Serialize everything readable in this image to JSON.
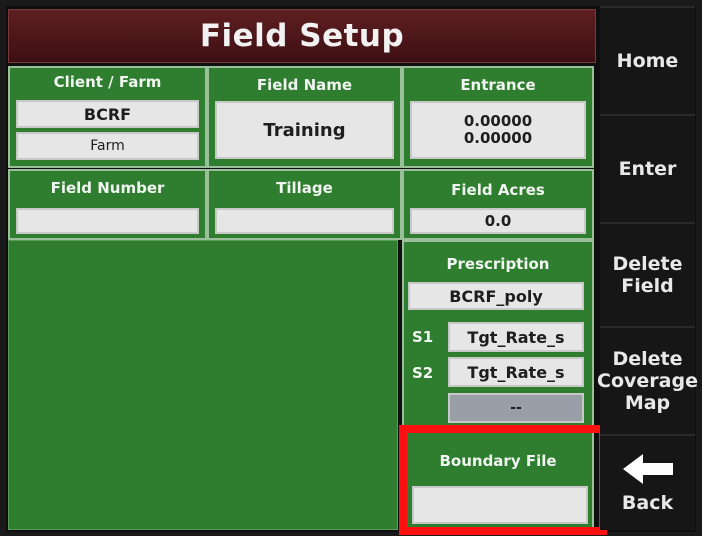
{
  "header": {
    "title": "Field Setup"
  },
  "client_farm": {
    "label": "Client / Farm",
    "client": "BCRF",
    "farm": "Farm"
  },
  "field_name": {
    "label": "Field Name",
    "value": "Training"
  },
  "entrance": {
    "label": "Entrance",
    "line1": "0.00000",
    "line2": "0.00000"
  },
  "field_number": {
    "label": "Field Number",
    "value": ""
  },
  "tillage": {
    "label": "Tillage",
    "value": ""
  },
  "field_acres": {
    "label": "Field Acres",
    "value": "0.0"
  },
  "prescription": {
    "label": "Prescription",
    "value": "BCRF_poly",
    "s1_label": "S1",
    "s1_value": "Tgt_Rate_s",
    "s2_label": "S2",
    "s2_value": "Tgt_Rate_s",
    "s3_value": "--"
  },
  "boundary": {
    "label": "Boundary File",
    "value": ""
  },
  "side_menu": {
    "home": "Home",
    "enter": "Enter",
    "delete_field_1": "Delete",
    "delete_field_2": "Field",
    "delete_cov_1": "Delete",
    "delete_cov_2": "Coverage",
    "delete_cov_3": "Map",
    "back": "Back"
  },
  "colors": {
    "panel_green": "#2f7d2f",
    "title_maroon": "#4e1417",
    "highlight_red": "#ff1010"
  }
}
